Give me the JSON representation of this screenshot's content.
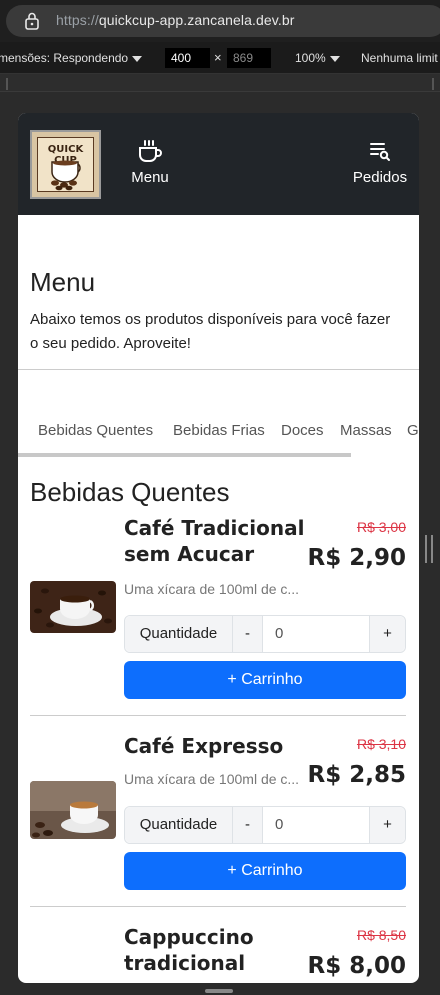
{
  "browser": {
    "url_scheme": "https://",
    "url_host": "quickcup-app.zancanela.dev.br"
  },
  "devtools": {
    "dimensions_label": "mensões: Respondendo",
    "width": "400",
    "times": "×",
    "height": "869",
    "zoom": "100%",
    "throttle": "Nenhuma limit"
  },
  "navbar": {
    "logo_text": "QUICK CUP",
    "menu_label": "Menu",
    "orders_label": "Pedidos"
  },
  "intro": {
    "title": "Menu",
    "description": "Abaixo temos os produtos disponíveis para você fazer o seu pedido. Aproveite!"
  },
  "tabs": [
    "Bebidas Quentes",
    "Bebidas Frias",
    "Doces",
    "Massas",
    "G"
  ],
  "section_title": "Bebidas Quentes",
  "products": [
    {
      "name_line1": "Café Tradicional",
      "name_line2": "sem Acucar",
      "old_price": "R$ 3,00",
      "price": "R$ 2,90",
      "description": "Uma xícara de 100ml de c...",
      "qty_label": "Quantidade",
      "minus": "-",
      "qty_value": "0",
      "plus": "+",
      "cart_label": "+ Carrinho"
    },
    {
      "name_line1": "Café Expresso",
      "name_line2": "",
      "old_price": "R$ 3,10",
      "price": "R$ 2,85",
      "description": "Uma xícara de 100ml de c...",
      "qty_label": "Quantidade",
      "minus": "-",
      "qty_value": "0",
      "plus": "+",
      "cart_label": "+ Carrinho"
    },
    {
      "name_line1": "Cappuccino",
      "name_line2": "tradicional",
      "old_price": "R$ 8,50",
      "price": "R$ 8,00"
    }
  ],
  "colors": {
    "navbar": "#212529",
    "primary": "#0d6efd",
    "old_price": "#dc3545"
  }
}
